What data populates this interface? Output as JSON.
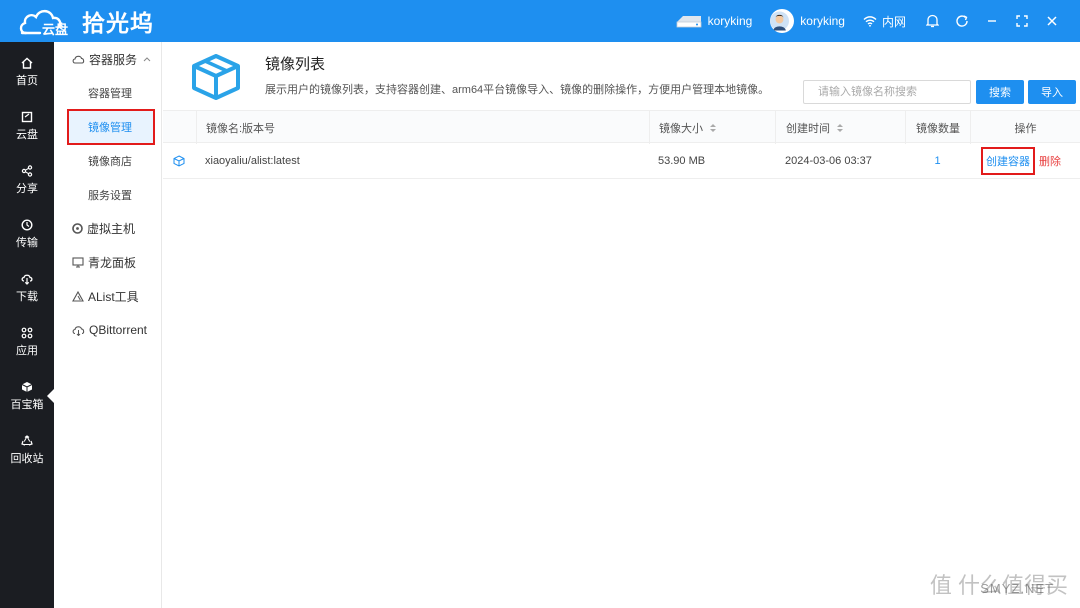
{
  "app": {
    "logo_cloud_text": "云盘",
    "logo_name": "拾光坞"
  },
  "topbar": {
    "device_name": "koryking",
    "user_name": "koryking",
    "network_label": "内网"
  },
  "leftnav": {
    "items": [
      {
        "label": "首页",
        "icon": "home-icon"
      },
      {
        "label": "云盘",
        "icon": "cloud-disk-icon"
      },
      {
        "label": "分享",
        "icon": "share-icon"
      },
      {
        "label": "传输",
        "icon": "transfer-icon"
      },
      {
        "label": "下载",
        "icon": "download-icon"
      },
      {
        "label": "应用",
        "icon": "apps-icon"
      },
      {
        "label": "百宝箱",
        "icon": "toolbox-icon"
      },
      {
        "label": "回收站",
        "icon": "recycle-icon"
      }
    ],
    "active": "百宝箱"
  },
  "subnav": {
    "group_container": "容器服务",
    "items": [
      "容器管理",
      "镜像管理",
      "镜像商店",
      "服务设置"
    ],
    "active": "镜像管理",
    "other_groups": [
      "虚拟主机",
      "青龙面板",
      "AList工具",
      "QBittorrent"
    ]
  },
  "main": {
    "title": "镜像列表",
    "description": "展示用户的镜像列表，支持容器创建、arm64平台镜像导入、镜像的删除操作，方便用户管理本地镜像。",
    "search_placeholder": "请输入镜像名称搜索",
    "search_button": "搜索",
    "import_button": "导入",
    "columns": [
      "镜像名:版本号",
      "镜像大小",
      "创建时间",
      "镜像数量",
      "操作"
    ],
    "rows": [
      {
        "name": "xiaoyaliu/alist:latest",
        "size": "53.90 MB",
        "created": "2024-03-06 03:37",
        "count": "1",
        "actions": [
          "创建容器",
          "删除"
        ]
      }
    ]
  },
  "watermark": {
    "main": "值 什么值得买",
    "sub": "SMYZ.NET"
  },
  "colors": {
    "accent": "#1e8ff0",
    "nav_bg": "#1b1d22",
    "highlight_box": "#e21b1b",
    "delete": "#e84040"
  }
}
